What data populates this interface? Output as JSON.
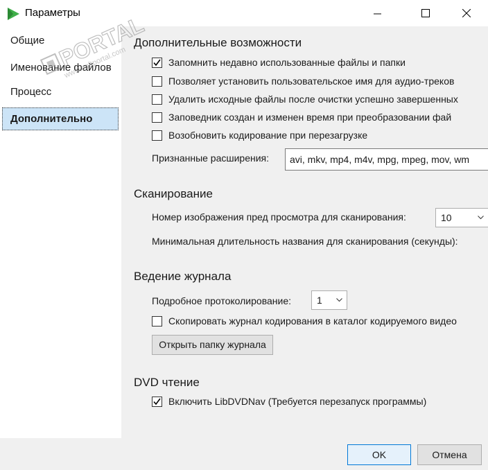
{
  "window": {
    "title": "Параметры",
    "minimize_icon": "minimize-icon",
    "maximize_icon": "maximize-icon",
    "close_icon": "close-icon"
  },
  "sidebar": {
    "items": [
      {
        "label": "Общие",
        "selected": false
      },
      {
        "label": "Именование файлов",
        "selected": false
      },
      {
        "label": "Процесс",
        "selected": false
      },
      {
        "label": "Дополнительно",
        "selected": true
      }
    ],
    "selected_color": "#cce4f7"
  },
  "advanced": {
    "title": "Дополнительные возможности",
    "options": [
      {
        "label": "Запомнить недавно использованные файлы и папки",
        "checked": true
      },
      {
        "label": "Позволяет установить пользовательское имя для аудио-треков",
        "checked": false
      },
      {
        "label": "Удалить исходные файлы после очистки успешно завершенных",
        "checked": false
      },
      {
        "label": "Заповедник создан и изменен время при преобразовании фай",
        "checked": false
      },
      {
        "label": "Возобновить кодирование при перезагрузке",
        "checked": false
      }
    ],
    "extensions_label": "Признанные расширения:",
    "extensions_value": "avi, mkv, mp4, m4v, mpg, mpeg, mov, wm"
  },
  "scan": {
    "title": "Сканирование",
    "preview_label": "Номер изображения пред просмотра для сканирования:",
    "preview_value": "10",
    "min_duration_label": "Минимальная длительность названия для сканирования (секунды):"
  },
  "logging": {
    "title": "Ведение журнала",
    "verbose_label": "Подробное протоколирование:",
    "verbose_value": "1",
    "copy_log_label": "Скопировать журнал кодирования в каталог кодируемого видео",
    "copy_log_checked": false,
    "open_folder_button": "Открыть папку журнала"
  },
  "dvd": {
    "title": "DVD чтение",
    "libdvdnav_label": "Включить LibDVDNav (Требуется перезапуск программы)",
    "libdvdnav_checked": true
  },
  "footer": {
    "ok": "OK",
    "cancel": "Отмена"
  },
  "watermark": {
    "text": "PORTAL",
    "tm": "™",
    "url": "www.softportal.com"
  },
  "colors": {
    "content_bg": "#f0f0f0",
    "app_icon_green": "#3fae49"
  }
}
